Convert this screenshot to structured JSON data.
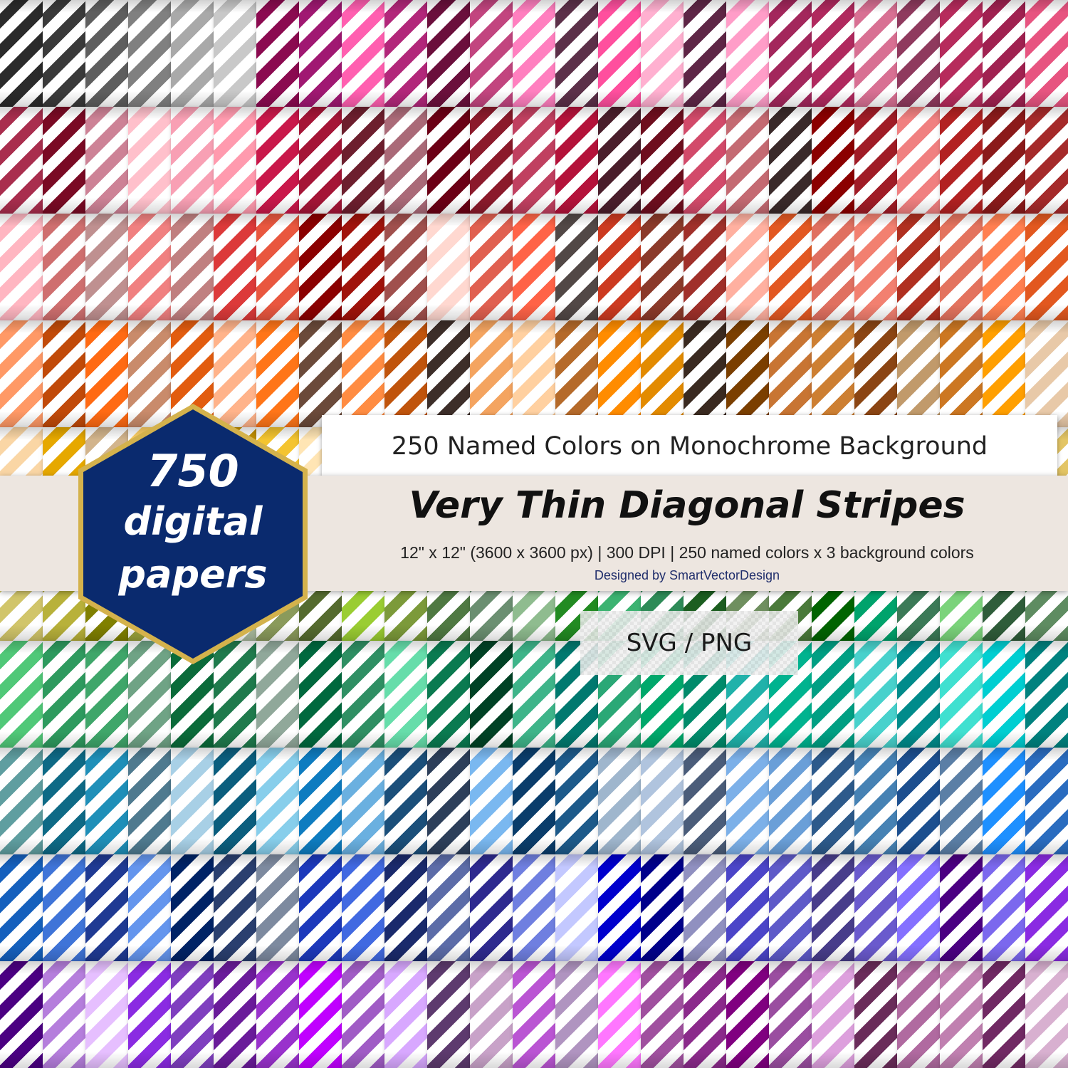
{
  "subtitle": "250 Named Colors on Monochrome Background",
  "title": "Very Thin Diagonal Stripes",
  "specs": "12\" x 12\" (3600 x 3600 px) | 300 DPI | 250 named colors x 3 background colors",
  "credit": "Designed by SmartVectorDesign",
  "formats": "SVG / PNG",
  "badge": {
    "number": "750",
    "line1": "digital",
    "line2": "papers",
    "fill_color": "#0a2a6e",
    "border_color": "#d4b24c"
  },
  "band_color": "#ede6e0",
  "stripe_background": "#ffffff",
  "swatch_rows": [
    [
      "#2b2b2b",
      "#3a3a3a",
      "#5e5e5e",
      "#808080",
      "#a9a9a9",
      "#c8c8c8",
      "#8b0a50",
      "#a01872",
      "#ff5fb0",
      "#b2277a",
      "#6b0f3c",
      "#c2457f",
      "#ff7fbf",
      "#5c3049",
      "#ff4f9e",
      "#ffb0d0",
      "#5e2646",
      "#ff9dc8",
      "#a3275c",
      "#b0295e",
      "#d87093",
      "#8f3a5e",
      "#b62b5c",
      "#a02150",
      "#e75480"
    ],
    [
      "#a92e4e",
      "#7a0a24",
      "#cd8296",
      "#ffc0cb",
      "#f8a0b4",
      "#ff9aae",
      "#c9184a",
      "#a51537",
      "#6d1f2e",
      "#aa6a78",
      "#6b0015",
      "#8b1a2b",
      "#c04060",
      "#b4123a",
      "#4a1e2b",
      "#6e0e1e",
      "#d24a6a",
      "#c46a72",
      "#3a2a2a",
      "#8b0000",
      "#a01c26",
      "#f08080",
      "#b22222",
      "#8b1a1a",
      "#a52a2a"
    ],
    [
      "#ffb6c1",
      "#cf6f6f",
      "#bf9090",
      "#f08080",
      "#c08080",
      "#dc3a3a",
      "#e9573f",
      "#8b0000",
      "#a0130b",
      "#a0504d",
      "#ffd8d0",
      "#e06050",
      "#ff6347",
      "#524846",
      "#cc3a20",
      "#8b3a2a",
      "#a0302a",
      "#ffb0a0",
      "#e25822",
      "#e07060",
      "#f28070",
      "#b03020",
      "#e3735e",
      "#ff7f50",
      "#e2581f"
    ],
    [
      "#ff9966",
      "#c14a09",
      "#ff6a13",
      "#c98b6b",
      "#e25c0f",
      "#ffb38a",
      "#ff7518",
      "#6b4a3a",
      "#ff8c42",
      "#c0540c",
      "#3d2e29",
      "#f4a460",
      "#ffd0a0",
      "#b56a2a",
      "#ff8c00",
      "#e38b00",
      "#3a2a20",
      "#7b3f00",
      "#c87533",
      "#cd7f32",
      "#8b4513",
      "#c19a6b",
      "#cc7722",
      "#ff9f00",
      "#e8c9a8"
    ],
    [
      "#fad6a5",
      "#e6a800",
      "#d2b48c",
      "#ffd166",
      "#ffa500",
      "#c49102",
      "#f4c430",
      "#ffe5b4",
      "#b8860b",
      "#e2c779",
      "#d4af37",
      "#ffdb58",
      "#e1ad01",
      "#cfb53b",
      "#f0e68c",
      "#c9b037",
      "#bdb76b",
      "#daa520",
      "#e0c068",
      "#b5a642",
      "#ffd700",
      "#c2b280",
      "#a68a2e",
      "#d9c36a",
      "#e3c565"
    ],
    [
      "#d1c56a",
      "#b8b13a",
      "#808000",
      "#9aa23a",
      "#6b8e23",
      "#a9ba9d",
      "#8a9a5b",
      "#556b2f",
      "#9acd32",
      "#7c9a3a",
      "#4f7942",
      "#6b8f71",
      "#8fbc8f",
      "#228b22",
      "#3cb371",
      "#2e8b57",
      "#1c5e20",
      "#6f8f5f",
      "#4a7a3a",
      "#006400",
      "#00a36c",
      "#3b7a57",
      "#7bd37b",
      "#2f5d3a",
      "#5e8c61"
    ],
    [
      "#50c878",
      "#2e9a5e",
      "#3fa66a",
      "#6fa385",
      "#0b6b3a",
      "#1f7a4c",
      "#90a89a",
      "#00693e",
      "#2f8f63",
      "#66ddaa",
      "#0a7a50",
      "#004225",
      "#3eb489",
      "#01796f",
      "#2aa876",
      "#00a86b",
      "#008b6b",
      "#20b2aa",
      "#00b38f",
      "#009f83",
      "#48d1cc",
      "#008b8b",
      "#40e0d0",
      "#00ced1",
      "#00827f"
    ],
    [
      "#5f9ea0",
      "#0e6a86",
      "#1f8fb8",
      "#4f7a8f",
      "#a8d0e6",
      "#0b5e7e",
      "#87ceeb",
      "#0e7cc0",
      "#6ab0e0",
      "#1b4f7a",
      "#2d3f5a",
      "#7ab8f0",
      "#0a3d6b",
      "#1d5a8a",
      "#9fb6cd",
      "#b0c4de",
      "#4b5d7a",
      "#7cb0e8",
      "#6a9fd8",
      "#2d5a8b",
      "#4682b4",
      "#1c4f8f",
      "#5b7fa6",
      "#1e90ff",
      "#2a6cbf"
    ],
    [
      "#1560bd",
      "#3f74d8",
      "#1f3a93",
      "#6495ed",
      "#002366",
      "#2a3f6f",
      "#7d8a9f",
      "#1c39bb",
      "#4169e1",
      "#1a2a6c",
      "#5c6ca8",
      "#2e2a8f",
      "#6f7fe0",
      "#c3c8ff",
      "#0000cd",
      "#00008b",
      "#9090c0",
      "#4b45c8",
      "#5e5ac8",
      "#483d8b",
      "#6a5acd",
      "#8470ff",
      "#4b0082",
      "#7b68ee",
      "#8a2be2"
    ],
    [
      "#4b0082",
      "#b57edc",
      "#e6bfff",
      "#8a2be2",
      "#7f3fbf",
      "#6a1b9a",
      "#9932cc",
      "#c000ff",
      "#a05cc5",
      "#d8a8ff",
      "#5d3a6e",
      "#c8a2c8",
      "#ba55d3",
      "#b094c0",
      "#ff77ff",
      "#a0509f",
      "#8b2a8b",
      "#800080",
      "#9a4ea0",
      "#dda0dd",
      "#6a2c5a",
      "#b06aa0",
      "#c080b0",
      "#702963",
      "#d8b0d0"
    ]
  ]
}
